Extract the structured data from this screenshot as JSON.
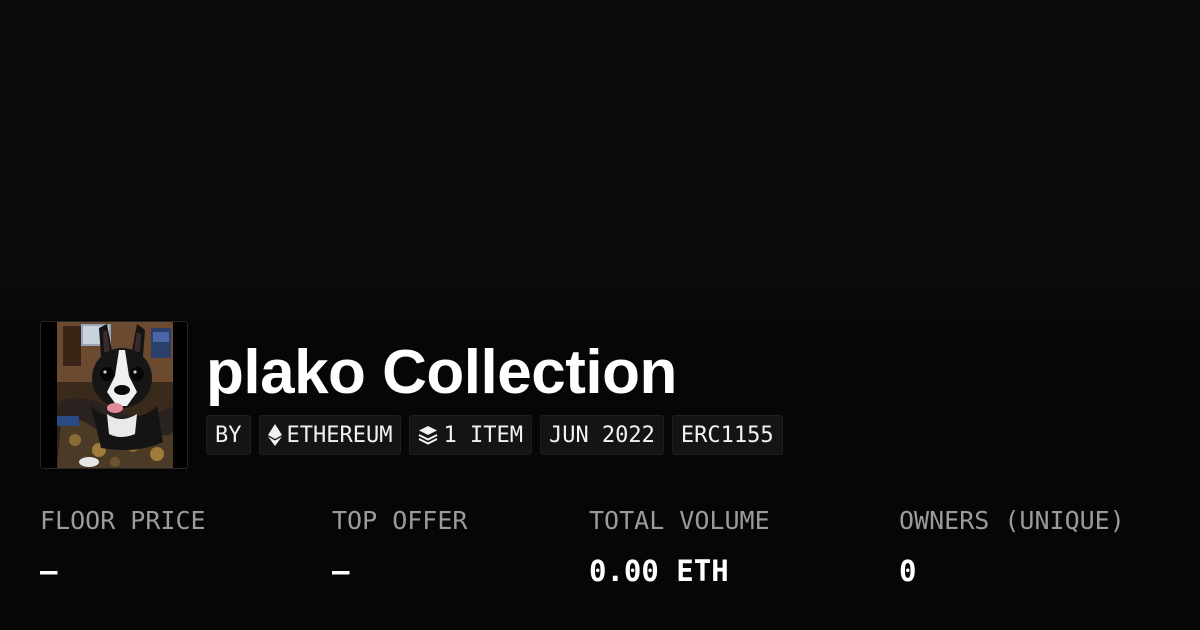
{
  "collection": {
    "name": "plako Collection",
    "avatar_alt": "Boston terrier photo"
  },
  "chips": {
    "by": "BY",
    "chain": "ETHEREUM",
    "chain_icon": "ethereum-icon",
    "items": "1 ITEM",
    "items_icon": "layers-icon",
    "date": "JUN 2022",
    "standard": "ERC1155"
  },
  "stats": {
    "floor_price": {
      "label": "FLOOR PRICE",
      "value": "—"
    },
    "top_offer": {
      "label": "TOP OFFER",
      "value": "—"
    },
    "total_volume": {
      "label": "TOTAL VOLUME",
      "value": "0.00 ETH"
    },
    "owners": {
      "label": "OWNERS (UNIQUE)",
      "value": "0"
    }
  },
  "colors": {
    "background": "#060606",
    "banner": "#0b0b0b",
    "chip_background": "#141414",
    "label_gray": "#9b9b9b",
    "text": "#ffffff"
  }
}
